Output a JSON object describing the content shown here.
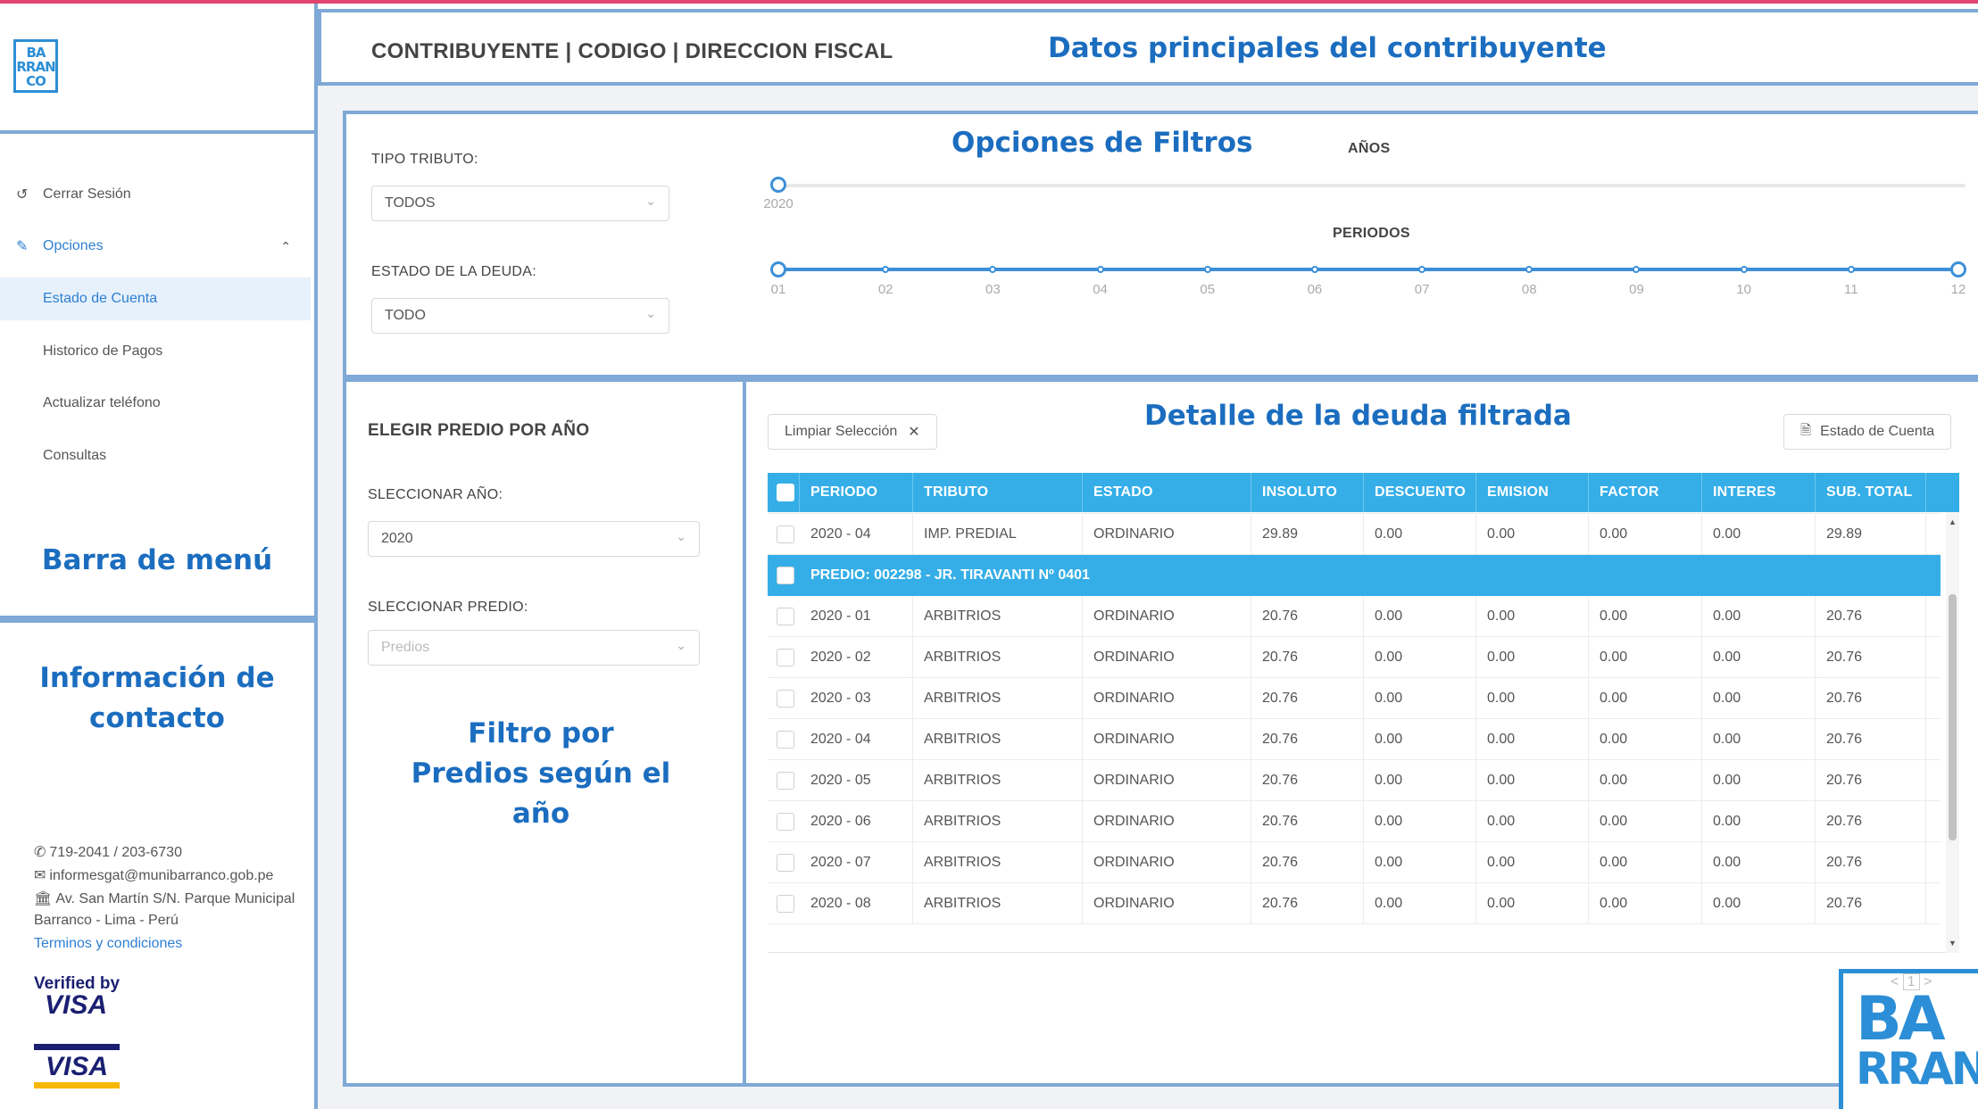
{
  "brand": {
    "logo_small": "BA RRAN CO",
    "logo_big_line1": "BA",
    "logo_big_line2": "RRAN",
    "colors": {
      "accent": "#35aee7",
      "frame": "#7fa9d6",
      "annotation": "#1b6dbf",
      "top_line": "#e0456f"
    }
  },
  "header": {
    "title": "CONTRIBUYENTE | CODIGO | DIRECCION FISCAL",
    "annotation": "Datos principales del contribuyente"
  },
  "sidebar": {
    "items": [
      {
        "label": "Cerrar Sesión",
        "icon": "logout-icon"
      },
      {
        "label": "Opciones",
        "icon": "edit-icon",
        "expanded": true
      },
      {
        "label": "Estado de Cuenta",
        "active": true
      },
      {
        "label": "Historico de Pagos"
      },
      {
        "label": "Actualizar teléfono"
      },
      {
        "label": "Consultas"
      }
    ],
    "annotation_menu": "Barra de menú",
    "annotation_contact": "Información de contacto",
    "contact": {
      "phone": "719-2041 / 203-6730",
      "email": "informesgat@munibarranco.gob.pe",
      "address": "Av. San Martín S/N. Parque Municipal",
      "city": "Barranco - Lima - Perú",
      "terms": "Terminos y condiciones"
    },
    "visa_verified_line1": "Verified by",
    "visa_verified_line2": "VISA",
    "visa_logo": "VISA"
  },
  "filters": {
    "annotation": "Opciones de Filtros",
    "tipo_tributo_label": "TIPO TRIBUTO:",
    "tipo_tributo_value": "TODOS",
    "estado_label": "ESTADO DE LA DEUDA:",
    "estado_value": "TODO",
    "anios_title": "AÑOS",
    "anios_marks": [
      "2020"
    ],
    "periodos_title": "PERIODOS",
    "periodos_marks": [
      "01",
      "02",
      "03",
      "04",
      "05",
      "06",
      "07",
      "08",
      "09",
      "10",
      "11",
      "12"
    ]
  },
  "predio_panel": {
    "title": "ELEGIR PREDIO POR AÑO",
    "anio_label": "SLECCIONAR AÑO:",
    "anio_value": "2020",
    "predio_label": "SLECCIONAR PREDIO:",
    "predio_placeholder": "Predios",
    "annotation": "Filtro por Predios según el año"
  },
  "detail": {
    "annotation": "Detalle de la deuda filtrada",
    "clear_button": "Limpiar Selección",
    "account_button": "Estado de Cuenta",
    "pager_value": "1",
    "columns": [
      "PERIODO",
      "TRIBUTO",
      "ESTADO",
      "INSOLUTO",
      "DESCUENTO",
      "EMISION",
      "FACTOR",
      "INTERES",
      "SUB. TOTAL"
    ],
    "rows_before": [
      {
        "periodo": "2020 - 04",
        "tributo": "IMP. PREDIAL",
        "estado": "ORDINARIO",
        "insoluto": "29.89",
        "descuento": "0.00",
        "emision": "0.00",
        "factor": "0.00",
        "interes": "0.00",
        "subtotal": "29.89"
      }
    ],
    "group_label": "PREDIO: 002298 - JR. TIRAVANTI Nº 0401",
    "rows_after": [
      {
        "periodo": "2020 - 01",
        "tributo": "ARBITRIOS",
        "estado": "ORDINARIO",
        "insoluto": "20.76",
        "descuento": "0.00",
        "emision": "0.00",
        "factor": "0.00",
        "interes": "0.00",
        "subtotal": "20.76"
      },
      {
        "periodo": "2020 - 02",
        "tributo": "ARBITRIOS",
        "estado": "ORDINARIO",
        "insoluto": "20.76",
        "descuento": "0.00",
        "emision": "0.00",
        "factor": "0.00",
        "interes": "0.00",
        "subtotal": "20.76"
      },
      {
        "periodo": "2020 - 03",
        "tributo": "ARBITRIOS",
        "estado": "ORDINARIO",
        "insoluto": "20.76",
        "descuento": "0.00",
        "emision": "0.00",
        "factor": "0.00",
        "interes": "0.00",
        "subtotal": "20.76"
      },
      {
        "periodo": "2020 - 04",
        "tributo": "ARBITRIOS",
        "estado": "ORDINARIO",
        "insoluto": "20.76",
        "descuento": "0.00",
        "emision": "0.00",
        "factor": "0.00",
        "interes": "0.00",
        "subtotal": "20.76"
      },
      {
        "periodo": "2020 - 05",
        "tributo": "ARBITRIOS",
        "estado": "ORDINARIO",
        "insoluto": "20.76",
        "descuento": "0.00",
        "emision": "0.00",
        "factor": "0.00",
        "interes": "0.00",
        "subtotal": "20.76"
      },
      {
        "periodo": "2020 - 06",
        "tributo": "ARBITRIOS",
        "estado": "ORDINARIO",
        "insoluto": "20.76",
        "descuento": "0.00",
        "emision": "0.00",
        "factor": "0.00",
        "interes": "0.00",
        "subtotal": "20.76"
      },
      {
        "periodo": "2020 - 07",
        "tributo": "ARBITRIOS",
        "estado": "ORDINARIO",
        "insoluto": "20.76",
        "descuento": "0.00",
        "emision": "0.00",
        "factor": "0.00",
        "interes": "0.00",
        "subtotal": "20.76"
      },
      {
        "periodo": "2020 - 08",
        "tributo": "ARBITRIOS",
        "estado": "ORDINARIO",
        "insoluto": "20.76",
        "descuento": "0.00",
        "emision": "0.00",
        "factor": "0.00",
        "interes": "0.00",
        "subtotal": "20.76"
      }
    ]
  }
}
